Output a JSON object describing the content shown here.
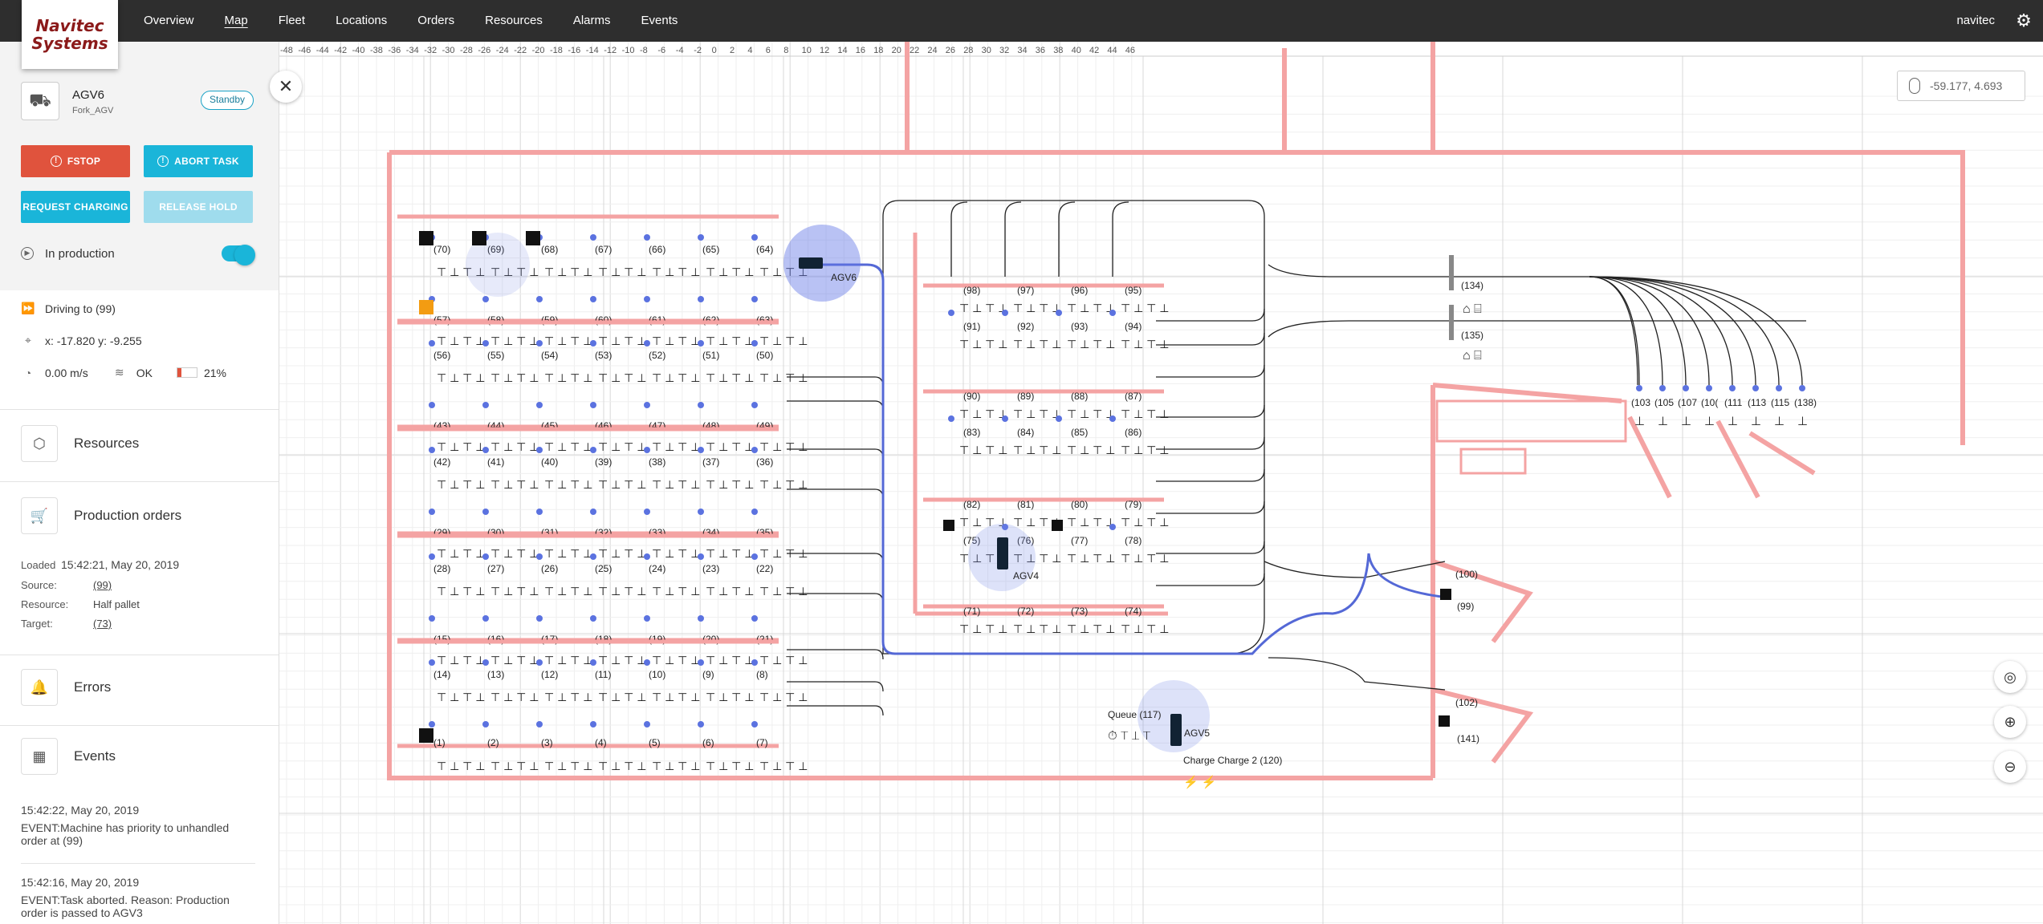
{
  "brand": {
    "line1": "Navitec",
    "line2": "Systems"
  },
  "nav": [
    {
      "label": "Overview",
      "active": false
    },
    {
      "label": "Map",
      "active": true
    },
    {
      "label": "Fleet",
      "active": false
    },
    {
      "label": "Locations",
      "active": false
    },
    {
      "label": "Orders",
      "active": false
    },
    {
      "label": "Resources",
      "active": false
    },
    {
      "label": "Alarms",
      "active": false
    },
    {
      "label": "Events",
      "active": false
    }
  ],
  "user": "navitec",
  "vehicle": {
    "name": "AGV6",
    "type": "Fork_AGV",
    "status": "Standby",
    "buttons": {
      "fstop": "FSTOP",
      "abort": "ABORT TASK",
      "charge": "REQUEST CHARGING",
      "release": "RELEASE HOLD"
    },
    "production_label": "In production",
    "production_on": true,
    "driving": "Driving to (99)",
    "position": "x: -17.820 y: -9.255",
    "speed": "0.00 m/s",
    "network": "OK",
    "battery": "21%",
    "battery_fraction": 0.21
  },
  "sections": {
    "resources": "Resources",
    "orders": "Production orders",
    "errors": "Errors",
    "events": "Events"
  },
  "order": {
    "status": "Loaded",
    "time": "15:42:21, May 20, 2019",
    "source_label": "Source:",
    "source": "(99)",
    "resource_label": "Resource:",
    "resource": "Half pallet",
    "target_label": "Target:",
    "target": "(73)"
  },
  "events": [
    {
      "time": "15:42:22, May 20, 2019",
      "text": "EVENT:Machine has priority to unhandled order at (99)"
    },
    {
      "time": "15:42:16, May 20, 2019",
      "text": "EVENT:Task aborted. Reason: Production order is passed to AGV3"
    }
  ],
  "map": {
    "mouse_coords": "-59.177, 4.693",
    "axis_labels": [
      "-48",
      "-46",
      "-44",
      "-42",
      "-40",
      "-38",
      "-36",
      "-34",
      "-32",
      "-30",
      "-28",
      "-26",
      "-24",
      "-22",
      "-20",
      "-18",
      "-16",
      "-14",
      "-12",
      "-10",
      "-8",
      "-6",
      "-4",
      "-2",
      "0",
      "2",
      "4",
      "6",
      "8",
      "10",
      "12",
      "14",
      "16",
      "18",
      "20",
      "22",
      "24",
      "26",
      "28",
      "30",
      "32",
      "34",
      "36",
      "38",
      "40",
      "42",
      "44",
      "46"
    ],
    "left_rows": [
      {
        "top": [
          "(70)",
          "(69)",
          "(68)",
          "(67)",
          "(66)",
          "(65)",
          "(64)"
        ],
        "bottom": [
          "(57)",
          "(58)",
          "(59)",
          "(60)",
          "(61)",
          "(62)",
          "(63)"
        ]
      },
      {
        "top": [
          "(56)",
          "(55)",
          "(54)",
          "(53)",
          "(52)",
          "(51)",
          "(50)"
        ],
        "bottom": [
          "(43)",
          "(44)",
          "(45)",
          "(46)",
          "(47)",
          "(48)",
          "(49)"
        ]
      },
      {
        "top": [
          "(42)",
          "(41)",
          "(40)",
          "(39)",
          "(38)",
          "(37)",
          "(36)"
        ],
        "bottom": [
          "(29)",
          "(30)",
          "(31)",
          "(32)",
          "(33)",
          "(34)",
          "(35)"
        ]
      },
      {
        "top": [
          "(28)",
          "(27)",
          "(26)",
          "(25)",
          "(24)",
          "(23)",
          "(22)"
        ],
        "bottom": [
          "(15)",
          "(16)",
          "(17)",
          "(18)",
          "(19)",
          "(20)",
          "(21)"
        ]
      },
      {
        "top": [
          "(14)",
          "(13)",
          "(12)",
          "(11)",
          "(10)",
          "(9)",
          "(8)"
        ],
        "bottom": [
          "(1)",
          "(2)",
          "(3)",
          "(4)",
          "(5)",
          "(6)",
          "(7)"
        ]
      }
    ],
    "mid_rows": [
      {
        "top": [
          "(98)",
          "(97)",
          "(96)",
          "(95)"
        ],
        "bottom": [
          "(91)",
          "(92)",
          "(93)",
          "(94)"
        ]
      },
      {
        "top": [
          "(90)",
          "(89)",
          "(88)",
          "(87)"
        ],
        "bottom": [
          "(83)",
          "(84)",
          "(85)",
          "(86)"
        ]
      },
      {
        "top": [
          "(82)",
          "(81)",
          "(80)",
          "(79)"
        ],
        "bottom": [
          "(75)",
          "(76)",
          "(77)",
          "(78)"
        ]
      },
      {
        "top": [
          "(71)",
          "(72)",
          "(73)",
          "(74)"
        ],
        "bottom": []
      }
    ],
    "right_labels": [
      "(134)",
      "(135)",
      "(100)",
      "(99)",
      "(102)",
      "(141)"
    ],
    "bank_labels": [
      "(103",
      "(105",
      "(107",
      "(10(",
      "(111",
      "(113",
      "(115",
      "(138)"
    ],
    "agvs": [
      "AGV6",
      "AGV4",
      "AGV5"
    ],
    "queue_label": "Queue (117)",
    "charge_label": "Charge Charge 2 (120)"
  }
}
